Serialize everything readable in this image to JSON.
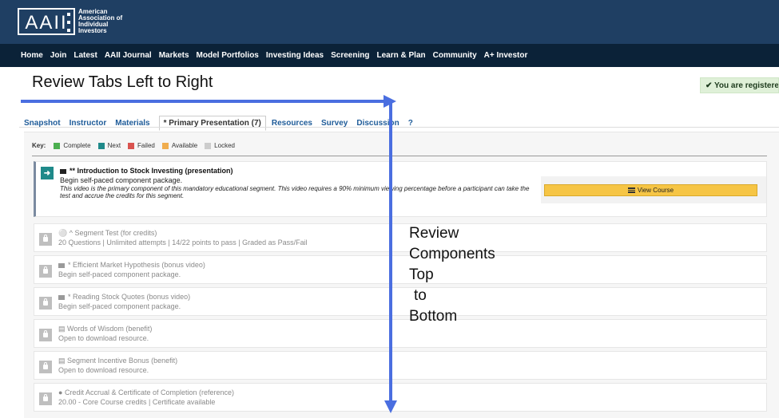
{
  "header": {
    "logo_letters": "AAII",
    "logo_lines": [
      "American",
      "Association of",
      "Individual",
      "Investors"
    ],
    "nav": [
      "Home",
      "Join",
      "Latest",
      "AAII Journal",
      "Markets",
      "Model Portfolios",
      "Investing Ideas",
      "Screening",
      "Learn & Plan",
      "Community",
      "A+ Investor"
    ]
  },
  "annotations": {
    "title": "Review Tabs Left to Right",
    "side_lines": [
      "Review",
      "Components",
      "Top",
      "to",
      "Bottom"
    ]
  },
  "registered": "✔ You are registered!",
  "tabs": [
    {
      "label": "Snapshot",
      "active": false
    },
    {
      "label": "Instructor",
      "active": false
    },
    {
      "label": "Materials",
      "active": false
    },
    {
      "label": "* Primary Presentation (7)",
      "active": true
    },
    {
      "label": "Resources",
      "active": false
    },
    {
      "label": "Survey",
      "active": false
    },
    {
      "label": "Discussion",
      "active": false
    },
    {
      "label": "?",
      "active": false
    }
  ],
  "key": {
    "label": "Key:",
    "items": [
      {
        "label": "Complete",
        "color": "#4caf50"
      },
      {
        "label": "Next",
        "color": "#1f8a8a"
      },
      {
        "label": "Failed",
        "color": "#d9534f"
      },
      {
        "label": "Available",
        "color": "#f0ad4e"
      },
      {
        "label": "Locked",
        "color": "#cccccc"
      }
    ]
  },
  "items": [
    {
      "title": "** Introduction to Stock Investing (presentation)",
      "subtitle": "Begin self-paced component package.",
      "description": "This video is the primary component of this mandatory educational segment. This video requires a 90% minimum viewing percentage before a participant can take the test and accrue the credits for this segment.",
      "button": "View Course",
      "status": "next"
    },
    {
      "title": "^ Segment Test (for credits)",
      "subtitle": "20 Questions  |  Unlimited attempts  |  14/22 points to pass  |  Graded as Pass/Fail",
      "icon": "test-icon"
    },
    {
      "title": "* Efficient Market Hypothesis (bonus video)",
      "subtitle": "Begin self-paced component package.",
      "icon": "folder-icon"
    },
    {
      "title": "* Reading Stock Quotes (bonus video)",
      "subtitle": "Begin self-paced component package.",
      "icon": "folder-icon"
    },
    {
      "title": "Words of Wisdom (benefit)",
      "subtitle": "Open to download resource.",
      "icon": "document-icon"
    },
    {
      "title": "Segment Incentive Bonus (benefit)",
      "subtitle": "Open to download resource.",
      "icon": "document-icon"
    },
    {
      "title": "Credit Accrual & Certificate of Completion (reference)",
      "subtitle": "20.00 - Core Course credits  |  Certificate available",
      "icon": "circle-icon"
    }
  ]
}
